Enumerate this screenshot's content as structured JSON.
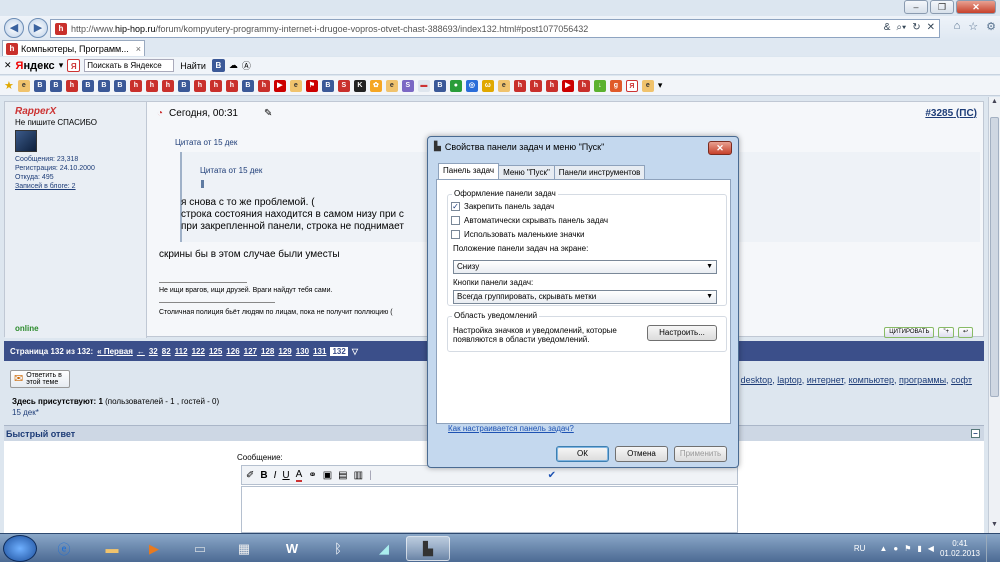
{
  "browser": {
    "url_prefix": "http://www.",
    "url_domain": "hip-hop.ru",
    "url_rest": "/forum/kompyutery-programmy-internet-i-drugoe-vopros-otvet-chast-388693/index132.html#post1077056432",
    "tab_title": "Компьютеры, Программ...",
    "tab_close": "×",
    "window_min": "–",
    "window_max": "❐",
    "window_close": "✕"
  },
  "yandex_toolbar": {
    "logo_prefix": "Я",
    "logo_rest": "ндекс",
    "search_placeholder": "Поискать в Яндексе",
    "find_label": "Найти"
  },
  "post": {
    "username": "RapperX",
    "user_title": "Не пишите СПАСИБО",
    "stats": [
      "Сообщения: 23,318",
      "Регистрация: 24.10.2000",
      "Откуда: 495",
      "Записей в блоге: 2"
    ],
    "online": "online",
    "date_label": "Сегодня, 00:31",
    "post_number": "#3285",
    "post_ps": "(ПС)",
    "quote_outer": "Цитата от 15 дек",
    "quote_inner": "Цитата от 15 дек",
    "quote_text": "я снова с то же проблемой. (\nстрока состояния находится в самом низу при с\nпри закрепленной панели, строка не поднимает",
    "body": "скрины бы в этом случае были уместы",
    "sig1": "Не ищи врагов, ищи друзей. Враги найдут тебя сами.",
    "sig2": "Столичная полиция бьёт людям по лицам, пока не получит поллюцию (",
    "quote_button": "ЦИТИРОВАТЬ"
  },
  "pager": {
    "label": "Страница 132 из 132:",
    "first": "« Первая",
    "prev": "←",
    "pages": [
      "32",
      "82",
      "112",
      "122",
      "125",
      "126",
      "127",
      "128",
      "129",
      "130",
      "131"
    ],
    "current": "132"
  },
  "reply_button": "Ответить в этой теме",
  "tags": [
    "desktop",
    "laptop",
    "интернет",
    "компьютер",
    "программы",
    "софт"
  ],
  "present_bold": "Здесь присутствуют: 1",
  "present_rest": "(пользователей - 1 , гостей - 0)",
  "present_user": "15 дек*",
  "quick_reply": {
    "title": "Быстрый ответ",
    "message_label": "Сообщение:"
  },
  "dialog": {
    "title": "Свойства панели задач и меню \"Пуск\"",
    "tabs": [
      "Панель задач",
      "Меню \"Пуск\"",
      "Панели инструментов"
    ],
    "group1_label": "Оформление панели задач",
    "checkboxes": [
      {
        "label": "Закрепить панель задач",
        "checked": true
      },
      {
        "label": "Автоматически скрывать панель задач",
        "checked": false
      },
      {
        "label": "Использовать маленькие значки",
        "checked": false
      }
    ],
    "position_label": "Положение панели задач на экране:",
    "position_value": "Снизу",
    "buttons_label": "Кнопки панели задач:",
    "buttons_value": "Всегда группировать, скрывать метки",
    "group2_label": "Область уведомлений",
    "notify_text": "Настройка значков и уведомлений, которые\nпоявляются в области уведомлений.",
    "configure": "Настроить...",
    "help_link": "Как настраивается панель задач?",
    "ok": "ОК",
    "cancel": "Отмена",
    "apply": "Применить"
  },
  "taskbar": {
    "lang": "RU",
    "time": "0:41",
    "date": "01.02.2013"
  }
}
